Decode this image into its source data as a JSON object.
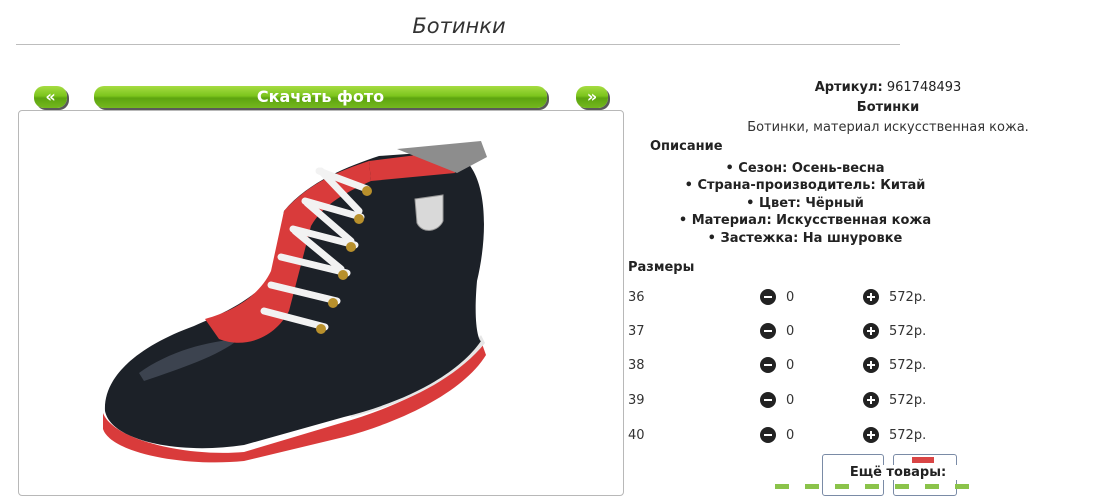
{
  "page": {
    "title": "Ботинки"
  },
  "gallery": {
    "prev_label": "«",
    "download_label": "Скачать фото",
    "next_label": "»"
  },
  "product": {
    "sku_label": "Артикул:",
    "sku_value": "961748493",
    "name": "Ботинки",
    "short_description": "Ботинки, материал искусственная кожа.",
    "description_heading": "Описание",
    "properties": [
      "Сезон: Осень-весна",
      "Страна-производитель: Китай",
      "Цвет: Чёрный",
      "Материал: Искусственная кожа",
      "Застежка: На шнуровке"
    ]
  },
  "sizes": {
    "heading": "Размеры",
    "rows": [
      {
        "size": "36",
        "qty": "0",
        "price": "572р."
      },
      {
        "size": "37",
        "qty": "0",
        "price": "572р."
      },
      {
        "size": "38",
        "qty": "0",
        "price": "572р."
      },
      {
        "size": "39",
        "qty": "0",
        "price": "572р."
      },
      {
        "size": "40",
        "qty": "0",
        "price": "572р."
      }
    ]
  },
  "more": {
    "label": "Ещё товары:"
  },
  "colors": {
    "button_green": "#7cc51d",
    "shoe_black": "#1c2128",
    "shoe_red": "#d93b3b"
  }
}
